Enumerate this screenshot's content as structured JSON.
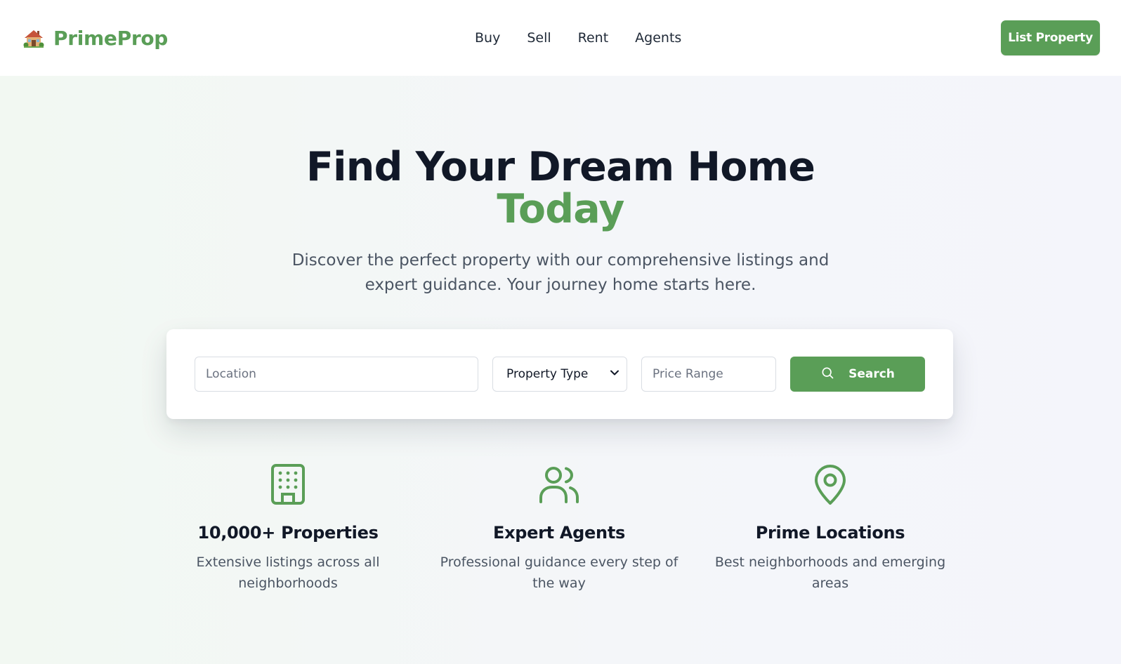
{
  "header": {
    "brand_name": "PrimeProp",
    "brand_icon": "house-icon",
    "nav": [
      "Buy",
      "Sell",
      "Rent",
      "Agents"
    ],
    "cta_label": "List Property"
  },
  "hero": {
    "title_line1": "Find Your Dream Home",
    "title_line2": "Today",
    "subtitle": "Discover the perfect property with our comprehensive listings and expert guidance. Your journey home starts here."
  },
  "search": {
    "location_placeholder": "Location",
    "location_value": "",
    "property_type_selected": "Property Type",
    "price_placeholder": "Price Range",
    "price_value": "",
    "button_label": "Search",
    "button_icon": "search-icon"
  },
  "features": [
    {
      "icon": "building-icon",
      "title": "10,000+ Properties",
      "description": "Extensive listings across all neighborhoods"
    },
    {
      "icon": "users-icon",
      "title": "Expert Agents",
      "description": "Professional guidance every step of the way"
    },
    {
      "icon": "map-pin-icon",
      "title": "Prime Locations",
      "description": "Best neighborhoods and emerging areas"
    }
  ],
  "colors": {
    "brand_green": "#5a9e57",
    "heading": "#111827",
    "body_text": "#4b5563"
  }
}
